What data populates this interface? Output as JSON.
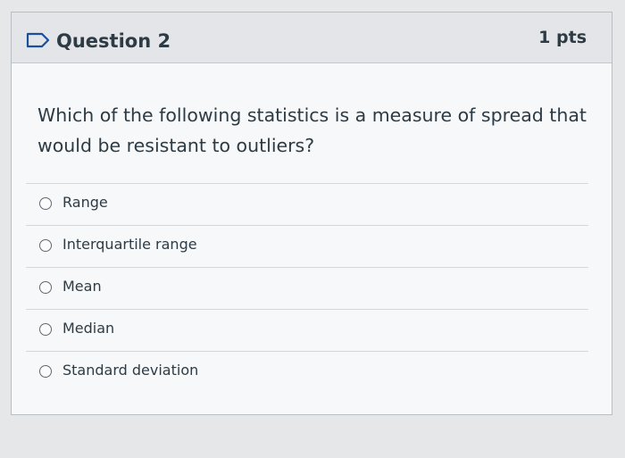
{
  "question": {
    "title": "Question 2",
    "points": "1 pts",
    "text": "Which of the following statistics is a measure of spread that would be resistant to outliers?",
    "flag_icon": "flag-outline-icon",
    "answers": [
      {
        "label": "Range",
        "selected": false
      },
      {
        "label": "Interquartile range",
        "selected": false
      },
      {
        "label": "Mean",
        "selected": false
      },
      {
        "label": "Median",
        "selected": false
      },
      {
        "label": "Standard deviation",
        "selected": false
      }
    ]
  },
  "colors": {
    "background": "#e6e7e9",
    "header": "#e3e5e8",
    "text": "#2d3b45",
    "flag": "#1a4f9c"
  }
}
